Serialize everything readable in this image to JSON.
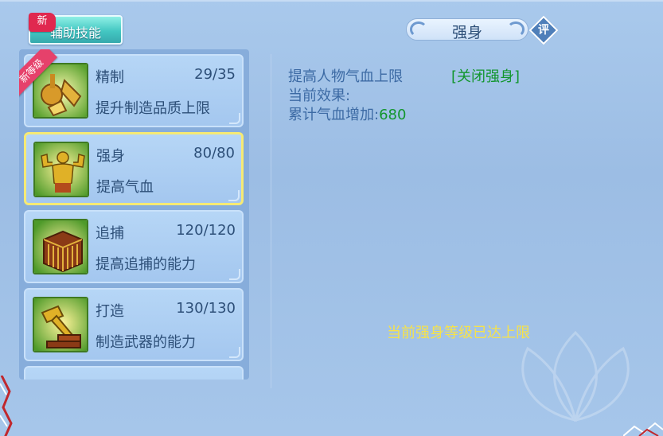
{
  "header": {
    "tab_label": "辅助技能",
    "new_badge": "新"
  },
  "skills": [
    {
      "name": "精制",
      "level": "29/35",
      "desc": "提升制造品质上限",
      "ribbon": "新等级",
      "icon": "crafting-tools-icon",
      "selected": false
    },
    {
      "name": "强身",
      "level": "80/80",
      "desc": "提高气血",
      "icon": "muscle-man-icon",
      "selected": true
    },
    {
      "name": "追捕",
      "level": "120/120",
      "desc": "提高追捕的能力",
      "icon": "cage-icon",
      "selected": false
    },
    {
      "name": "打造",
      "level": "130/130",
      "desc": "制造武器的能力",
      "icon": "hammer-anvil-icon",
      "selected": false
    }
  ],
  "detail": {
    "title": "强身",
    "rate_label": "评",
    "description": "提高人物气血上限",
    "toggle_label": "[关闭强身]",
    "current_effect_label": "当前效果:",
    "accumulated_label": "累计气血增加:",
    "accumulated_value": "680",
    "max_notice": "当前强身等级已达上限"
  },
  "colors": {
    "background": "#a6c6ea",
    "text_primary": "#2d4f78",
    "text_info": "#3c6aa4",
    "value_green": "#12962d",
    "notice_yellow": "#f6e24a",
    "selected_border": "#f6ea74",
    "ribbon_pink": "#e6416b"
  }
}
